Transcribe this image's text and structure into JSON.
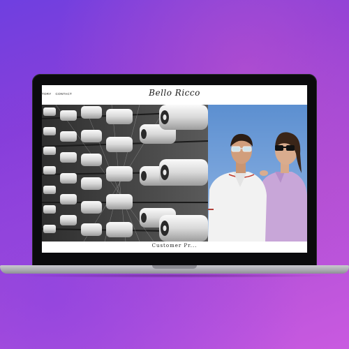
{
  "site": {
    "nav": [
      "TORY",
      "CONTACT"
    ],
    "logo": "Bello Ricco",
    "subtitle": "Customer Pr..."
  },
  "colors": {
    "background_start": "#6f3fe0",
    "background_end": "#c95ae0",
    "laptop_bezel": "#0b0b0d",
    "screen_bg": "#ffffff",
    "sky": "#6a9ad6",
    "shirt_white": "#f2f2f2",
    "shirt_lilac": "#c8a6d8"
  },
  "images": {
    "left": "industrial-thread-spools-photo",
    "right": "couple-in-polo-shirts-photo"
  }
}
